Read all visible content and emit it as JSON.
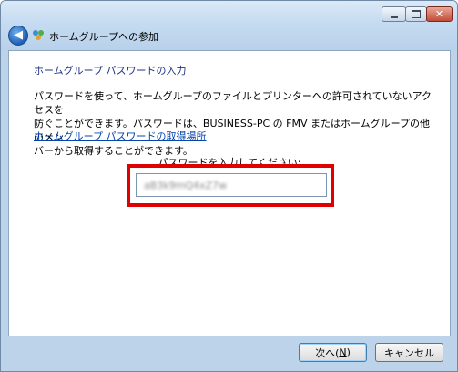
{
  "window": {
    "title": "ホームグループへの参加"
  },
  "content": {
    "heading": "ホームグループ パスワードの入力",
    "description_line1": "パスワードを使って、ホームグループのファイルとプリンターへの許可されていないアクセスを",
    "description_line2": "防ぐことができます。パスワードは、BUSINESS-PC の FMV またはホームグループの他のメン",
    "description_line3": "バーから取得することができます。",
    "link": "ホームグループ パスワードの取得場所",
    "password_label": "パスワードを入力してください:",
    "password_value_blurred": "aB3k9mQ4xZ7w"
  },
  "buttons": {
    "next_text": "次へ(",
    "next_key": "N",
    "next_close": ")",
    "cancel": "キャンセル"
  },
  "colors": {
    "highlight": "#e00000",
    "heading": "#1e3287",
    "link": "#0645ad",
    "frame": "#bcd3ea"
  },
  "icons": {
    "back": "back-arrow-icon",
    "app": "homegroup-icon",
    "minimize": "minimize-icon",
    "maximize": "maximize-icon",
    "close": "close-icon"
  }
}
